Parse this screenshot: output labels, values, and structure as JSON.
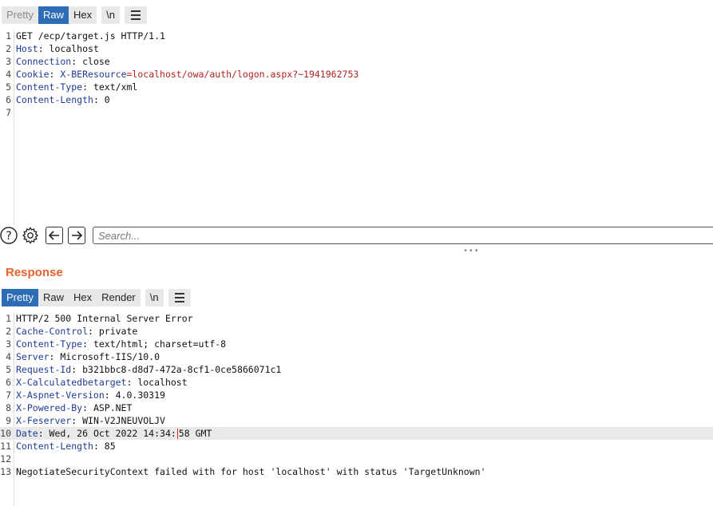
{
  "request": {
    "tabs": [
      {
        "label": "Pretty",
        "state": "dim"
      },
      {
        "label": "Raw",
        "state": "active"
      },
      {
        "label": "Hex",
        "state": "normal"
      }
    ],
    "newline_label": "\\n",
    "menu_icon": "hamburger-menu-icon",
    "lines": [
      {
        "num": "1",
        "parts": [
          {
            "t": "GET /ecp/target.js HTTP/1.1",
            "c": ""
          }
        ]
      },
      {
        "num": "2",
        "parts": [
          {
            "t": "Host",
            "c": "hname"
          },
          {
            "t": ": localhost",
            "c": ""
          }
        ]
      },
      {
        "num": "3",
        "parts": [
          {
            "t": "Connection",
            "c": "hname"
          },
          {
            "t": ": close",
            "c": ""
          }
        ]
      },
      {
        "num": "4",
        "parts": [
          {
            "t": "Cookie",
            "c": "hname"
          },
          {
            "t": ": ",
            "c": ""
          },
          {
            "t": "X-BEResource",
            "c": "hname"
          },
          {
            "t": "=localhost/owa/auth/logon.aspx?~1941962753",
            "c": "ck"
          }
        ]
      },
      {
        "num": "5",
        "parts": [
          {
            "t": "Content-Type",
            "c": "hname"
          },
          {
            "t": ": text/xml",
            "c": ""
          }
        ]
      },
      {
        "num": "6",
        "parts": [
          {
            "t": "Content-Length",
            "c": "hname"
          },
          {
            "t": ": 0",
            "c": ""
          }
        ]
      },
      {
        "num": "7",
        "parts": []
      }
    ]
  },
  "search": {
    "placeholder": "Search...",
    "icons": [
      "help-icon",
      "settings-gear-icon",
      "arrow-left-icon",
      "arrow-right-icon"
    ]
  },
  "response": {
    "title": "Response",
    "tabs": [
      {
        "label": "Pretty",
        "state": "active"
      },
      {
        "label": "Raw",
        "state": "normal"
      },
      {
        "label": "Hex",
        "state": "normal"
      },
      {
        "label": "Render",
        "state": "normal"
      }
    ],
    "newline_label": "\\n",
    "lines": [
      {
        "num": "1",
        "parts": [
          {
            "t": "HTTP/2 500 Internal Server Error",
            "c": ""
          }
        ]
      },
      {
        "num": "2",
        "parts": [
          {
            "t": "Cache-Control",
            "c": "hname"
          },
          {
            "t": ": private",
            "c": ""
          }
        ]
      },
      {
        "num": "3",
        "parts": [
          {
            "t": "Content-Type",
            "c": "hname"
          },
          {
            "t": ": text/html; charset=utf-8",
            "c": ""
          }
        ]
      },
      {
        "num": "4",
        "parts": [
          {
            "t": "Server",
            "c": "hname"
          },
          {
            "t": ": Microsoft-IIS/10.0",
            "c": ""
          }
        ]
      },
      {
        "num": "5",
        "parts": [
          {
            "t": "Request-Id",
            "c": "hname"
          },
          {
            "t": ": b321bbc8-d8d7-472a-8cf1-0ce5866071c1",
            "c": ""
          }
        ]
      },
      {
        "num": "6",
        "parts": [
          {
            "t": "X-Calculatedbetarget",
            "c": "hname"
          },
          {
            "t": ": localhost",
            "c": ""
          }
        ]
      },
      {
        "num": "7",
        "parts": [
          {
            "t": "X-Aspnet-Version",
            "c": "hname"
          },
          {
            "t": ": 4.0.30319",
            "c": ""
          }
        ]
      },
      {
        "num": "8",
        "parts": [
          {
            "t": "X-Powered-By",
            "c": "hname"
          },
          {
            "t": ": ASP.NET",
            "c": ""
          }
        ]
      },
      {
        "num": "9",
        "parts": [
          {
            "t": "X-Feserver",
            "c": "hname"
          },
          {
            "t": ": WIN-V2JNEUVOLJV",
            "c": ""
          }
        ]
      },
      {
        "num": "10",
        "highlight": true,
        "parts": [
          {
            "t": "Date",
            "c": "hname"
          },
          {
            "t": ": Wed, 26 Oct 2022 14:34:",
            "c": ""
          },
          {
            "t": "",
            "c": "caret"
          },
          {
            "t": "58 GMT",
            "c": ""
          }
        ]
      },
      {
        "num": "11",
        "parts": [
          {
            "t": "Content-Length",
            "c": "hname"
          },
          {
            "t": ": 85",
            "c": ""
          }
        ]
      },
      {
        "num": "12",
        "parts": []
      },
      {
        "num": "13",
        "parts": [
          {
            "t": "NegotiateSecurityContext failed with for host 'localhost' with status 'TargetUnknown'",
            "c": ""
          }
        ]
      }
    ]
  },
  "colors": {
    "accent": "#2e6cb5",
    "response_title": "#e8602c",
    "header_name": "#1f3a93",
    "cookie_value": "#b21f1f"
  }
}
